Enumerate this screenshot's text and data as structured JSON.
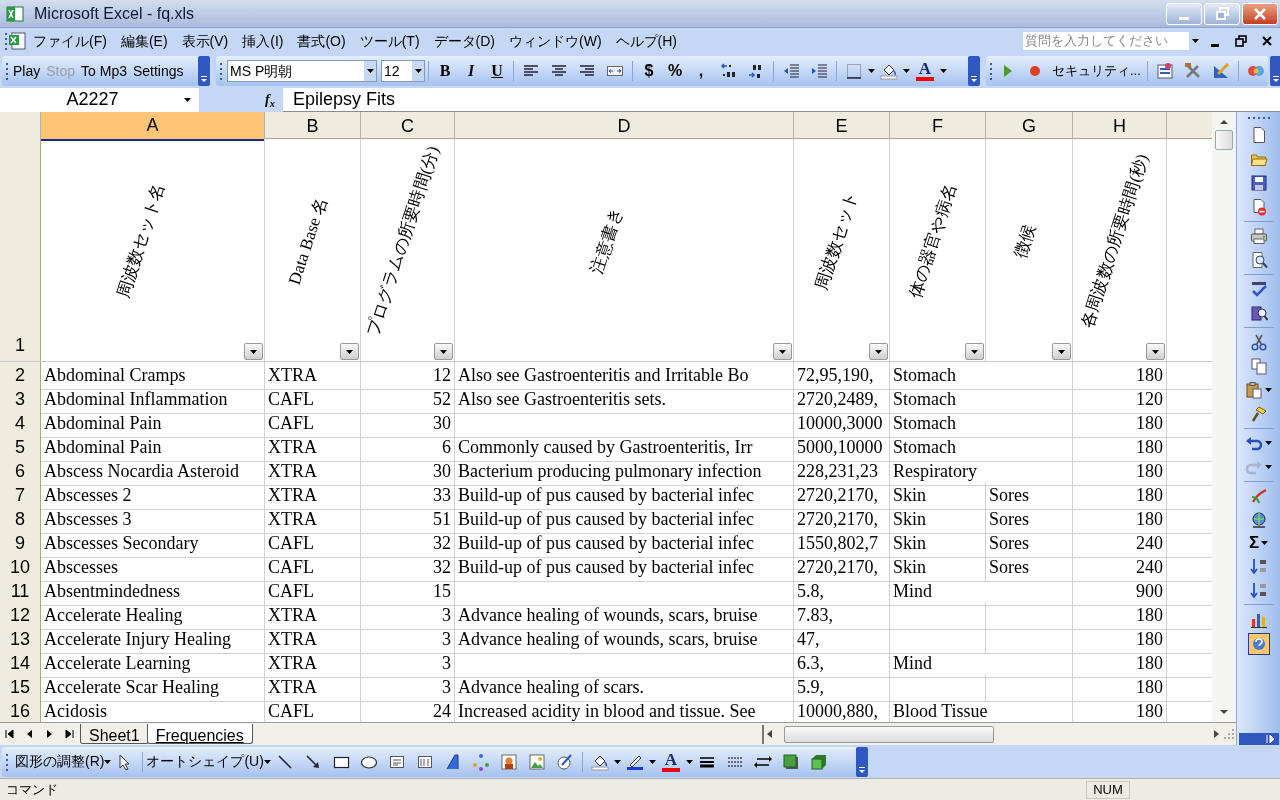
{
  "window": {
    "title": "Microsoft Excel - fq.xls"
  },
  "menu": [
    "ファイル(F)",
    "編集(E)",
    "表示(V)",
    "挿入(I)",
    "書式(O)",
    "ツール(T)",
    "データ(D)",
    "ウィンドウ(W)",
    "ヘルプ(H)"
  ],
  "help_search": {
    "placeholder": "質問を入力してください"
  },
  "macro_toolbar": [
    {
      "label": "Play",
      "disabled": false
    },
    {
      "label": "Stop",
      "disabled": true
    },
    {
      "label": "To Mp3",
      "disabled": false
    },
    {
      "label": "Settings",
      "disabled": false
    }
  ],
  "formatting_toolbar": {
    "font": "MS P明朝",
    "size": "12",
    "bold": "B",
    "italic": "I",
    "underline": "U",
    "currency": "$",
    "percent": "%",
    "comma": ",",
    "font_color": "A"
  },
  "vb_toolbar": {
    "security": "セキュリティ..."
  },
  "name_box": "A2227",
  "function_label": "f$_{x}$",
  "formula": "Epilepsy Fits",
  "columns": [
    {
      "label": "A",
      "selected": true
    },
    {
      "label": "B",
      "selected": false
    },
    {
      "label": "C",
      "selected": false
    },
    {
      "label": "D",
      "selected": false
    },
    {
      "label": "E",
      "selected": false
    },
    {
      "label": "F",
      "selected": false
    },
    {
      "label": "G",
      "selected": false
    },
    {
      "label": "H",
      "selected": false
    }
  ],
  "header_row": {
    "number": "1",
    "titles": [
      "周波数セット名",
      "Data Base 名",
      "プログラムの所要時間(分)",
      "注意書き",
      "周波数セット",
      "体の器官や病名",
      "徴候",
      "各周波数の所要時間(秒)"
    ]
  },
  "rows": [
    {
      "number": "2",
      "cells": [
        "Abdominal Cramps",
        "XTRA",
        "12",
        "Also see Gastroenteritis and Irritable Bo",
        "72,95,190,",
        "Stomach",
        "",
        "180"
      ]
    },
    {
      "number": "3",
      "cells": [
        "Abdominal Inflammation",
        "CAFL",
        "52",
        "Also see Gastroenteritis sets.",
        "2720,2489,",
        "Stomach",
        "",
        "120"
      ]
    },
    {
      "number": "4",
      "cells": [
        "Abdominal Pain",
        "CAFL",
        "30",
        "",
        "10000,3000",
        "Stomach",
        "",
        "180"
      ]
    },
    {
      "number": "5",
      "cells": [
        "Abdominal Pain",
        "XTRA",
        "6",
        "Commonly caused by Gastroenteritis, Irr",
        "5000,10000",
        "Stomach",
        "",
        "180"
      ]
    },
    {
      "number": "6",
      "cells": [
        "Abscess Nocardia Asteroid",
        "XTRA",
        "30",
        "Bacterium producing pulmonary infection",
        "228,231,23",
        "Respiratory",
        "",
        "180"
      ]
    },
    {
      "number": "7",
      "cells": [
        "Abscesses 2",
        "XTRA",
        "33",
        "Build-up of pus caused by bacterial infec",
        "2720,2170,",
        "Skin",
        "Sores",
        "180"
      ]
    },
    {
      "number": "8",
      "cells": [
        "Abscesses 3",
        "XTRA",
        "51",
        "Build-up of pus caused by bacterial infec",
        "2720,2170,",
        "Skin",
        "Sores",
        "180"
      ]
    },
    {
      "number": "9",
      "cells": [
        "Abscesses Secondary",
        "CAFL",
        "32",
        "Build-up of pus caused by bacterial infec",
        "1550,802,7",
        "Skin",
        "Sores",
        "240"
      ]
    },
    {
      "number": "10",
      "cells": [
        "Abscesses",
        "CAFL",
        "32",
        "Build-up of pus caused by bacterial infec",
        "2720,2170,",
        "Skin",
        "Sores",
        "240"
      ]
    },
    {
      "number": "11",
      "cells": [
        "Absentmindedness",
        "CAFL",
        "15",
        "",
        "5.8,",
        "Mind",
        "",
        "900"
      ]
    },
    {
      "number": "12",
      "cells": [
        "Accelerate Healing",
        "XTRA",
        "3",
        "Advance healing of wounds, scars, bruise",
        "7.83,",
        "",
        "",
        "180"
      ]
    },
    {
      "number": "13",
      "cells": [
        "Accelerate Injury Healing",
        "XTRA",
        "3",
        "Advance healing of wounds, scars, bruise",
        "47,",
        "",
        "",
        "180"
      ]
    },
    {
      "number": "14",
      "cells": [
        "Accelerate Learning",
        "XTRA",
        "3",
        "",
        "6.3,",
        "Mind",
        "",
        "180"
      ]
    },
    {
      "number": "15",
      "cells": [
        "Accelerate Scar Healing",
        "XTRA",
        "3",
        "Advance healing of scars.",
        "5.9,",
        "",
        "",
        "180"
      ]
    },
    {
      "number": "16",
      "cells": [
        "Acidosis",
        "CAFL",
        "24",
        "Increased acidity in blood and tissue. See",
        "10000,880,",
        "Blood Tissue",
        "",
        "180"
      ]
    }
  ],
  "sheet_tabs": [
    {
      "label": "Sheet1",
      "selected": false
    },
    {
      "label": "Frequencies",
      "selected": true
    }
  ],
  "drawing_toolbar": {
    "draw": "図形の調整(R)",
    "autoshapes": "オートシェイプ(U)",
    "font_color": "A"
  },
  "right_toolbar": {
    "autosum": "Σ"
  },
  "status_bar": {
    "message": "コマンド",
    "num": "NUM"
  }
}
